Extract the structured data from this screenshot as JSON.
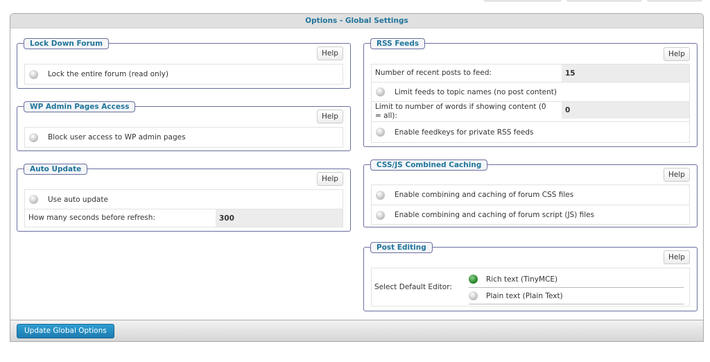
{
  "header": {
    "title": "Options - Global Settings"
  },
  "footer": {
    "update_label": "Update Global Options"
  },
  "help_label": "Help",
  "lockdown": {
    "legend": "Lock Down Forum",
    "option": "Lock the entire forum (read only)",
    "checked": false
  },
  "wpadmin": {
    "legend": "WP Admin Pages Access",
    "option": "Block user access to WP admin pages",
    "checked": false
  },
  "autoupdate": {
    "legend": "Auto Update",
    "option": "Use auto update",
    "checked": false,
    "refresh_label": "How many seconds before refresh:",
    "refresh_value": "300"
  },
  "rss": {
    "legend": "RSS Feeds",
    "posts_label": "Number of recent posts to feed:",
    "posts_value": "15",
    "limit_topic": "Limit feeds to topic names (no post content)",
    "words_label": "Limit to number of words if showing content (0 = all):",
    "words_value": "0",
    "feedkeys": "Enable feedkeys for private RSS feeds"
  },
  "caching": {
    "legend": "CSS/JS Combined Caching",
    "css": "Enable combining and caching of forum CSS files",
    "js": "Enable combining and caching of forum script (JS) files"
  },
  "editing": {
    "legend": "Post Editing",
    "label": "Select Default Editor:",
    "options": [
      {
        "label": "Rich text (TinyMCE)",
        "selected": true
      },
      {
        "label": "Plain text (Plain Text)",
        "selected": false
      }
    ]
  }
}
